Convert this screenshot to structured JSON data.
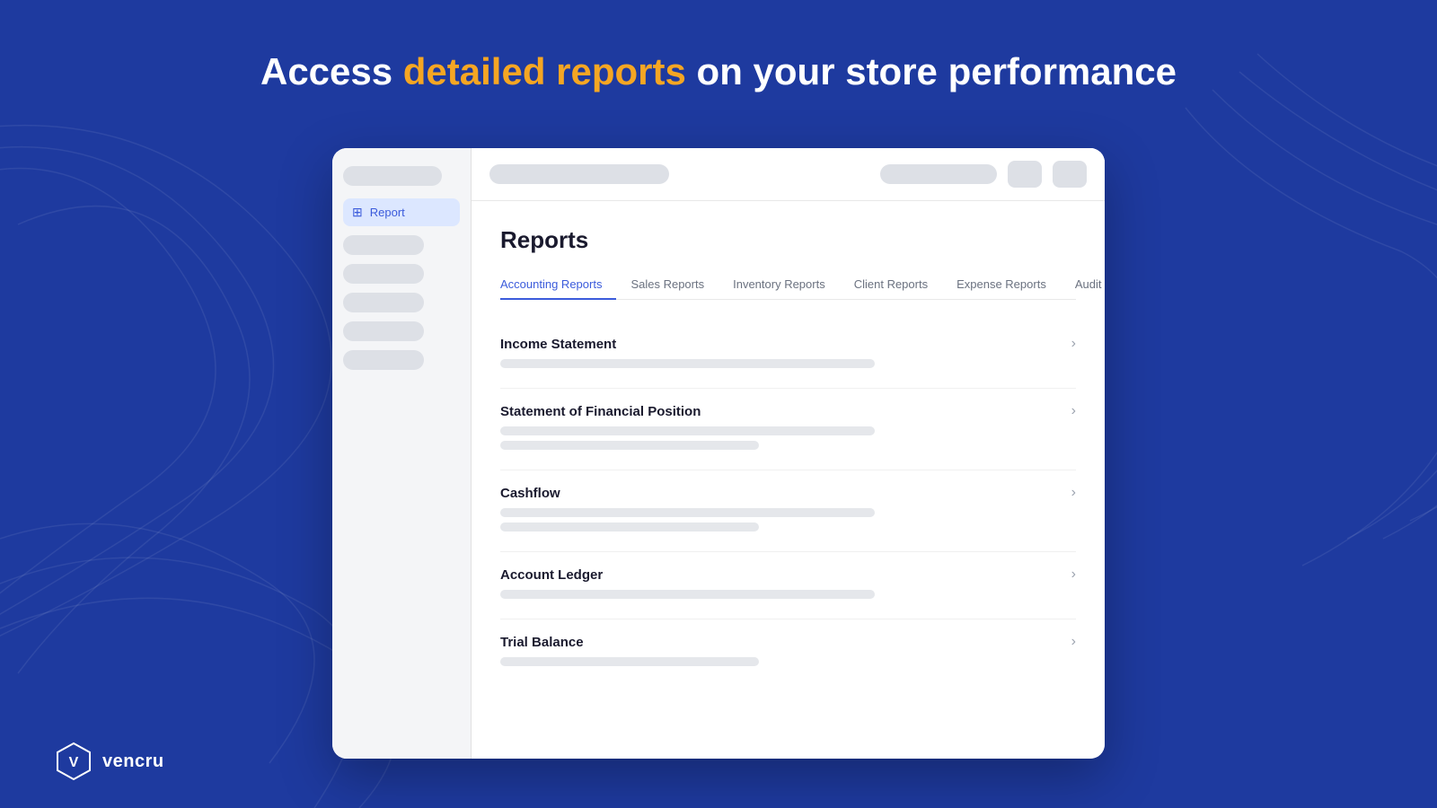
{
  "hero": {
    "title_part1": "Access ",
    "title_highlight": "detailed reports",
    "title_part2": " on your store performance"
  },
  "sidebar": {
    "report_label": "Report",
    "skeletons": [
      "wide",
      "medium",
      "medium",
      "medium",
      "medium",
      "medium"
    ]
  },
  "topbar": {
    "skeletons": [
      "large",
      "medium",
      "small",
      "small"
    ]
  },
  "reports_page": {
    "title": "Reports",
    "tabs": [
      {
        "label": "Accounting Reports",
        "active": true
      },
      {
        "label": "Sales Reports",
        "active": false
      },
      {
        "label": "Inventory Reports",
        "active": false
      },
      {
        "label": "Client Reports",
        "active": false
      },
      {
        "label": "Expense Reports",
        "active": false
      },
      {
        "label": "Audit Trial",
        "active": false
      }
    ],
    "items": [
      {
        "title": "Income Statement",
        "skeletons": [
          "long"
        ]
      },
      {
        "title": "Statement of Financial Position",
        "skeletons": [
          "long",
          "medium"
        ]
      },
      {
        "title": "Cashflow",
        "skeletons": [
          "long",
          "medium"
        ]
      },
      {
        "title": "Account Ledger",
        "skeletons": [
          "long"
        ]
      },
      {
        "title": "Trial Balance",
        "skeletons": [
          "medium"
        ]
      }
    ]
  },
  "brand": {
    "name": "vencru"
  },
  "colors": {
    "background": "#1e3a9f",
    "accent": "#f5a623",
    "primary": "#3b5bdb"
  }
}
